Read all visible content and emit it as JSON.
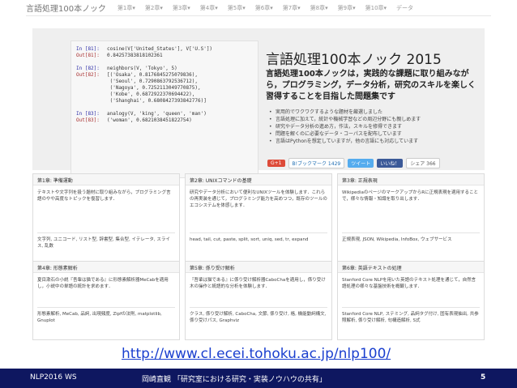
{
  "nav": {
    "brand": "言語処理100本ノック",
    "items": [
      "第1章▾",
      "第2章▾",
      "第3章▾",
      "第4章▾",
      "第5章▾",
      "第6章▾",
      "第7章▾",
      "第8章▾",
      "第9章▾",
      "第10章▾",
      "データ"
    ]
  },
  "code": {
    "lines": [
      {
        "prompt": "In [81]:",
        "text": "cosine(V['United_States'], V['U.S'])",
        "kind": "in"
      },
      {
        "prompt": "Out[81]:",
        "text": "0.84257383818102361",
        "kind": "out"
      },
      {
        "prompt": "",
        "text": "",
        "kind": "gap"
      },
      {
        "prompt": "In [82]:",
        "text": "neighbors(V, 'Tokyo', 5)",
        "kind": "in"
      },
      {
        "prompt": "Out[82]:",
        "text": "[('Osaka', 0.8176845275079836),",
        "kind": "out"
      },
      {
        "prompt": "",
        "text": " ('Seoul', 0.7290863792536712),",
        "kind": "out"
      },
      {
        "prompt": "",
        "text": " ('Nagoya', 0.7252113049770875),",
        "kind": "out"
      },
      {
        "prompt": "",
        "text": " ('Kobe', 0.6872922370694422),",
        "kind": "out"
      },
      {
        "prompt": "",
        "text": " ('Shanghai', 0.6808427393842776)]",
        "kind": "out"
      },
      {
        "prompt": "",
        "text": "",
        "kind": "gap"
      },
      {
        "prompt": "In [83]:",
        "text": "analogy(V, 'king', 'queen', 'man')",
        "kind": "in"
      },
      {
        "prompt": "Out[83]:",
        "text": "('woman', 0.6821038451822754)",
        "kind": "out"
      }
    ]
  },
  "hero": {
    "title": "言語処理100本ノック 2015",
    "lead": "言語処理100本ノックは，実践的な課題に取り組みながら，プログラミング，データ分析，研究のスキルを楽しく習得することを目指した問題集です",
    "bullets": [
      "実用的でワクワクするような題材を厳選しました",
      "言語処理に加えて，統計や機械学習などの周辺分野にも親しめます",
      "研究やデータ分析の進め方，作法，スキルを修得できます",
      "問題を解くのに必要なデータ・コーパスを配布しています",
      "言語はPythonを想定していますが，他の言語にも対応しています"
    ],
    "social": [
      "G+1",
      "B!ブックマーク 1429",
      "ツイート",
      "いいね！",
      "シェア 366"
    ]
  },
  "cards": [
    {
      "head": "第1章: 準備運動",
      "body": "テキストや文字列を扱う題材に取り組みながら，プログラミング言語のやや高度なトピックを復習します．",
      "topics": "文字列, ユニコード, リスト型, 辞書型, 集合型, イテレータ, スライス, 乱数"
    },
    {
      "head": "第2章: UNIXコマンドの基礎",
      "body": "研究やデータ分析において便利なUNIXツールを体験します．これらの再実装を通じて，プログラミング能力を高めつつ，既存のツールのエコシステムを体感します．",
      "topics": "head, tail, cut, paste, split, sort, uniq, sed, tr, expand"
    },
    {
      "head": "第3章: 正規表現",
      "body": "WikipediaのページのマークアップからRに正規表現を適用することで，様々な情報・知識を取り出します．",
      "topics": "正規表現, JSON, Wikipedia, InfoBox, ウェブサービス"
    },
    {
      "head": "第4章: 形態素解析",
      "body": "夏目漱石の小説『吾輩は猫である』に形態素解析器MeCabを適用し，小説中の単語の統計を求めます．",
      "topics": "形態素解析, MeCab, 品詞, 出現頻度, Zipfの法則, matplotlib, Gnuplot"
    },
    {
      "head": "第5章: 係り受け解析",
      "body": "『吾輩は猫である』に係り受け解析器CaboChaを適用し，係り受け木の操作と統語的な分析を体験します．",
      "topics": "クラス, 係り受け解析, CaboCha, 文節, 係り受け, 格, 機能動詞構文, 係り受けパス, Graphviz"
    },
    {
      "head": "第6章: 英語テキストの処理",
      "body": "Stanford Core NLPを用いた英語のテキスト処理を通じて，自然言語処理の様々な基盤技術を概観します．",
      "topics": "Stanford Core NLP, ステミング, 品詞タグ付け, 固有表現抽出, 共参照解析, 係り受け解析, 句構造解析, S式"
    }
  ],
  "url": "http://www.cl.ecei.tohoku.ac.jp/nlp100/",
  "footer": {
    "left": "NLP2016 WS",
    "middle": "岡崎直観 「研究室における研究・実装ノウハウの共有」",
    "page": "5"
  }
}
